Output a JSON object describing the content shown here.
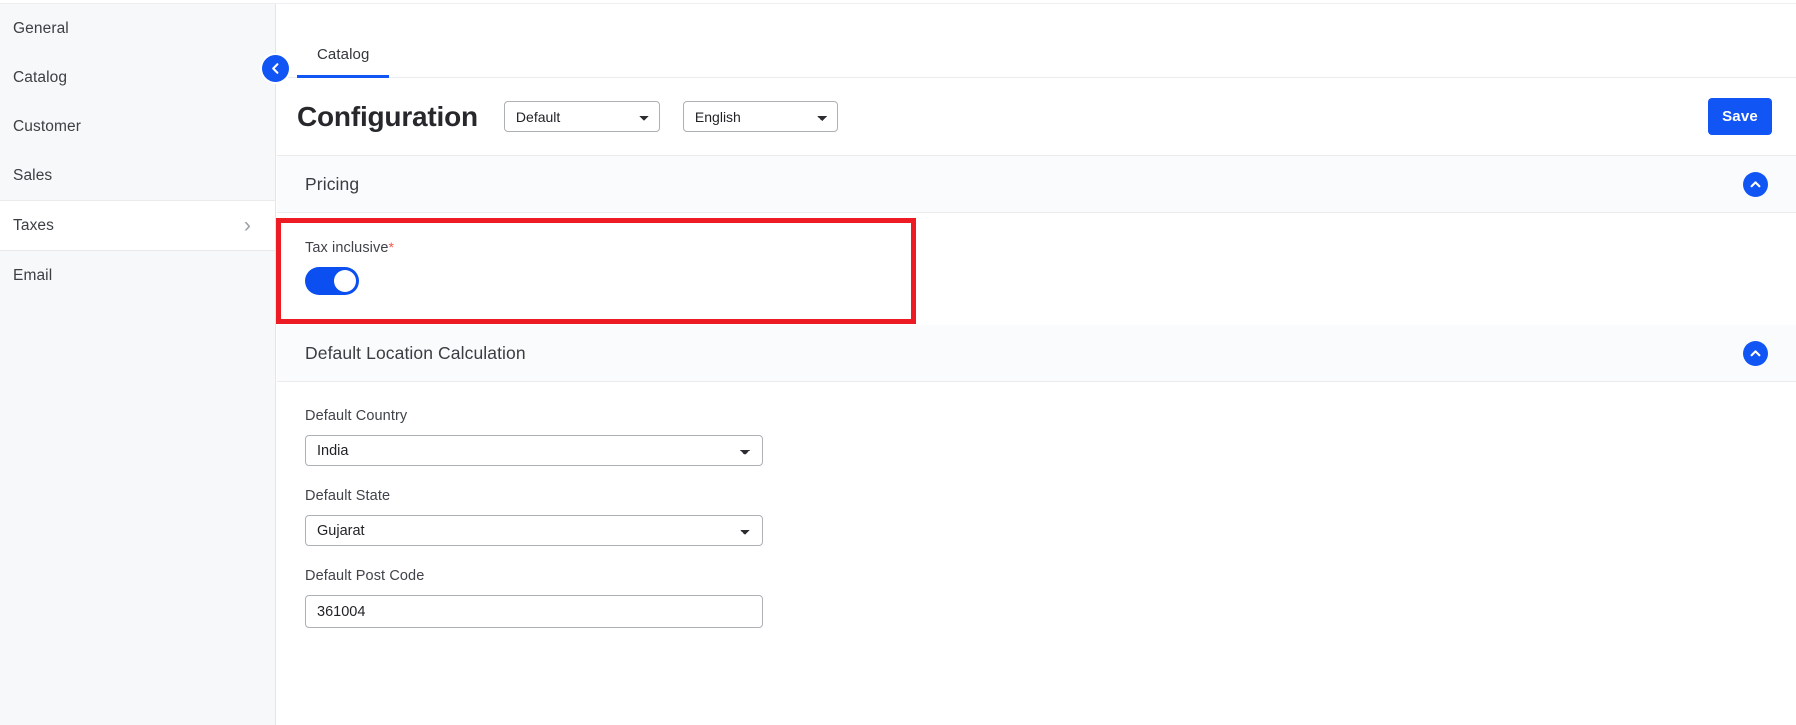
{
  "sidebar": {
    "items": [
      {
        "label": "General",
        "active": false
      },
      {
        "label": "Catalog",
        "active": false
      },
      {
        "label": "Customer",
        "active": false
      },
      {
        "label": "Sales",
        "active": false
      },
      {
        "label": "Taxes",
        "active": true
      },
      {
        "label": "Email",
        "active": false
      }
    ],
    "chevron_icon": "chevron-right-icon",
    "collapse_icon": "chevron-left-icon"
  },
  "tabs": [
    {
      "label": "Catalog",
      "active": true
    }
  ],
  "header": {
    "title": "Configuration",
    "store_scope": {
      "value": "Default",
      "options": [
        "Default"
      ]
    },
    "language": {
      "value": "English",
      "options": [
        "English"
      ]
    },
    "save_label": "Save"
  },
  "sections": [
    {
      "title": "Pricing",
      "collapse_icon": "chevron-up-icon",
      "fields": [
        {
          "label": "Tax inclusive",
          "required_marker": "*",
          "type": "toggle",
          "value": "on"
        }
      ]
    },
    {
      "title": "Default Location Calculation",
      "collapse_icon": "chevron-up-icon",
      "fields": [
        {
          "label": "Default Country",
          "type": "select",
          "value": "India",
          "options": [
            "India"
          ]
        },
        {
          "label": "Default State",
          "type": "select",
          "value": "Gujarat",
          "options": [
            "Gujarat"
          ]
        },
        {
          "label": "Default Post Code",
          "type": "text",
          "value": "361004",
          "placeholder": ""
        }
      ]
    }
  ],
  "colors": {
    "accent": "#1155f5",
    "toggle_on": "#0b4ff0",
    "annotation": "#ed1c24",
    "required": "#f0574d",
    "sidebar_bg": "#f7f8fa",
    "section_head_bg": "#fafbfc"
  }
}
